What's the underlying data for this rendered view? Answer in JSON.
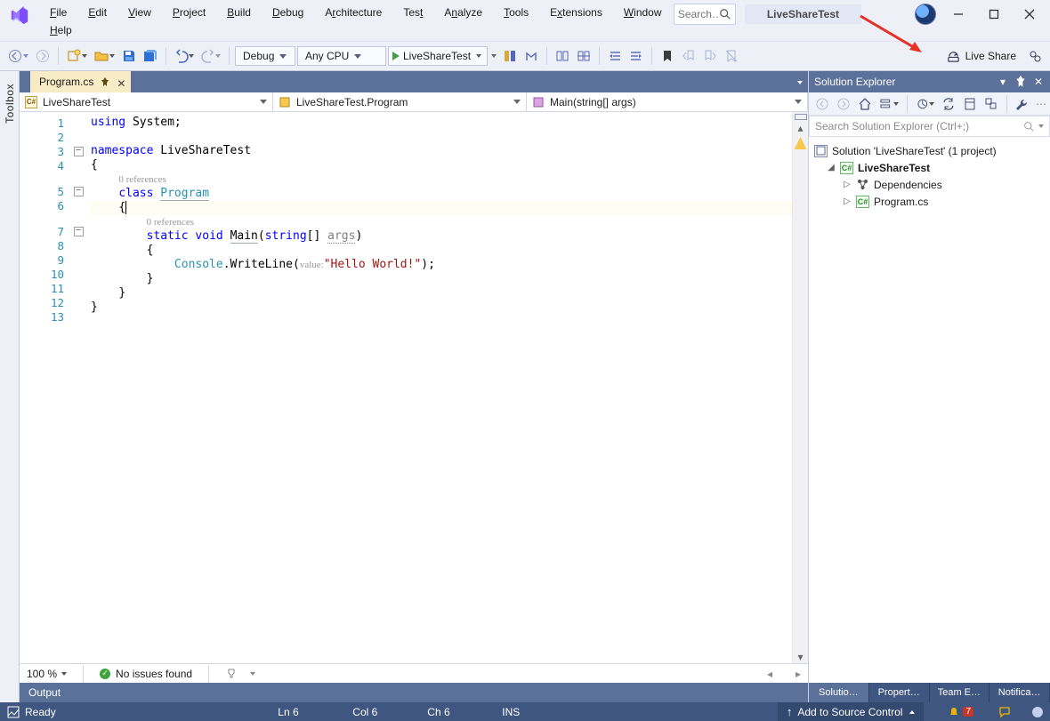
{
  "menus": {
    "file": "File",
    "edit": "Edit",
    "view": "View",
    "project": "Project",
    "build": "Build",
    "debug": "Debug",
    "architecture": "Architecture",
    "test": "Test",
    "analyze": "Analyze",
    "tools": "Tools",
    "extensions": "Extensions",
    "window": "Window",
    "help": "Help"
  },
  "header": {
    "search_placeholder": "Search…",
    "app_title": "LiveShareTest"
  },
  "toolbar": {
    "config": "Debug",
    "platform": "Any CPU",
    "start": "LiveShareTest",
    "live_share": "Live Share"
  },
  "doc_tab": {
    "name": "Program.cs"
  },
  "nav": {
    "scope": "LiveShareTest",
    "type": "LiveShareTest.Program",
    "member": "Main(string[] args)"
  },
  "code": {
    "lines": [
      "1",
      "2",
      "3",
      "4",
      "5",
      "6",
      "7",
      "8",
      "9",
      "10",
      "11",
      "12",
      "13"
    ],
    "l1_using": "using",
    "l1_system": " System;",
    "l3_ns": "namespace",
    "l3_name": " LiveShareTest",
    "l4": "{",
    "ref0": "0 references",
    "l5_class": "class ",
    "l5_prog": "Program",
    "l6": "{",
    "ref1": "0 references",
    "l7_static": "static ",
    "l7_void": "void ",
    "l7_main": "Main",
    "l7_open": "(",
    "l7_string": "string",
    "l7_arr": "[] ",
    "l7_args": "args",
    "l7_close": ")",
    "l8": "{",
    "l9_console": "Console",
    "l9_dot": ".WriteLine(",
    "l9_valann": "value:",
    "l9_str": "\"Hello World!\"",
    "l9_end": ");",
    "l10": "}",
    "l11": "}",
    "l12": "}"
  },
  "editor_footer": {
    "zoom": "100 %",
    "issues": "No issues found"
  },
  "output_panel": "Output",
  "solution_explorer": {
    "title": "Solution Explorer",
    "search_placeholder": "Search Solution Explorer (Ctrl+;)",
    "solution": "Solution 'LiveShareTest' (1 project)",
    "project": "LiveShareTest",
    "dependencies": "Dependencies",
    "file": "Program.cs",
    "tabs": {
      "sol": "Solutio…",
      "prop": "Propert…",
      "team": "Team E…",
      "notif": "Notifica…"
    }
  },
  "toolbox_label": "Toolbox",
  "status": {
    "ready": "Ready",
    "ln": "Ln 6",
    "col": "Col 6",
    "ch": "Ch 6",
    "ins": "INS",
    "src": "Add to Source Control",
    "notif_count": "7"
  }
}
